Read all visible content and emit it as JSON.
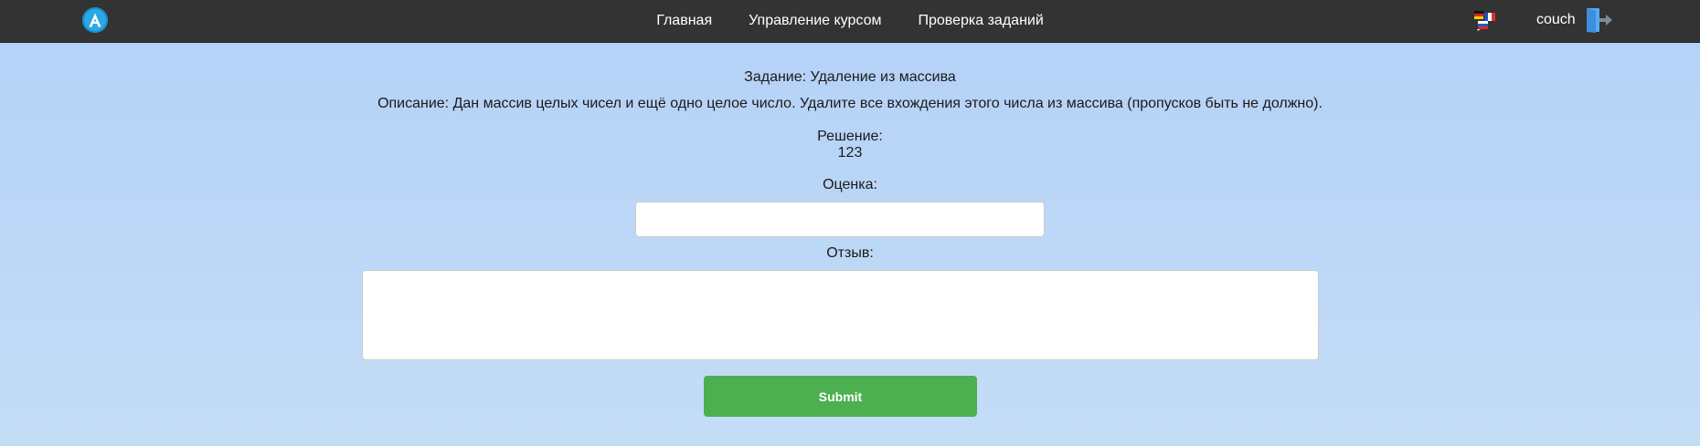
{
  "navbar": {
    "logo_letter": "A",
    "links": [
      {
        "label": "Главная"
      },
      {
        "label": "Управление курсом"
      },
      {
        "label": "Проверка заданий"
      }
    ],
    "language_icon": "language-flags-icon",
    "username": "couch",
    "logout_icon": "logout-door-icon"
  },
  "task": {
    "title": "Задание: Удаление из массива",
    "description": "Описание: Дан массив целых чисел и ещё одно целое число. Удалите все вхождения этого числа из массива (пропусков быть не должно).",
    "solution_label": "Решение:",
    "solution_value": "123"
  },
  "form": {
    "grade_label": "Оценка:",
    "grade_value": "",
    "review_label": "Отзыв:",
    "review_value": "",
    "submit_label": "Submit"
  },
  "colors": {
    "navbar_bg": "#333333",
    "accent_logo": "#2aa8e8",
    "submit_bg": "#4caf50",
    "page_bg_top": "#b3d1f7",
    "page_bg_bottom": "#c4ddf7"
  }
}
